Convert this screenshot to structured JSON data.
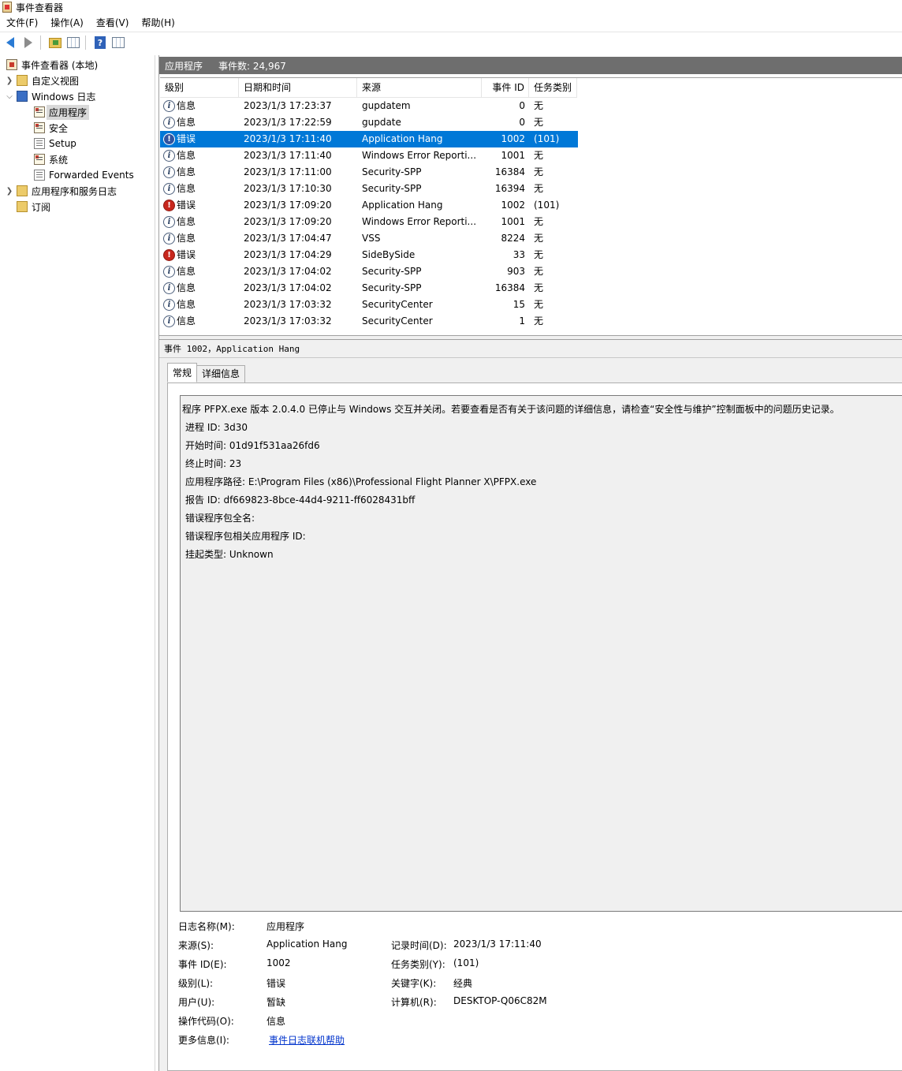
{
  "window": {
    "title": "事件查看器"
  },
  "menu": [
    "文件(F)",
    "操作(A)",
    "查看(V)",
    "帮助(H)"
  ],
  "nav": {
    "items": [
      {
        "label": "事件查看器 (本地)",
        "icon": "event-viewer-icon"
      },
      {
        "label": "自定义视图",
        "icon": "folder-icon"
      },
      {
        "label": "Windows 日志",
        "icon": "windows-log-icon"
      },
      {
        "label": "应用程序",
        "icon": "log-icon"
      },
      {
        "label": "安全",
        "icon": "log-icon"
      },
      {
        "label": "Setup",
        "icon": "doc-icon"
      },
      {
        "label": "系统",
        "icon": "log-icon"
      },
      {
        "label": "Forwarded Events",
        "icon": "doc-icon"
      },
      {
        "label": "应用程序和服务日志",
        "icon": "folder-icon"
      },
      {
        "label": "订阅",
        "icon": "subscription-icon"
      }
    ]
  },
  "list": {
    "name": "应用程序",
    "count": "事件数: 24,967",
    "columns": [
      "级别",
      "日期和时间",
      "来源",
      "事件 ID",
      "任务类别"
    ],
    "rows": [
      {
        "level": "信息",
        "type": "info",
        "date": "2023/1/3 17:23:37",
        "source": "gupdatem",
        "id": "0",
        "task": "无"
      },
      {
        "level": "信息",
        "type": "info",
        "date": "2023/1/3 17:22:59",
        "source": "gupdate",
        "id": "0",
        "task": "无"
      },
      {
        "level": "错误",
        "type": "error",
        "date": "2023/1/3 17:11:40",
        "source": "Application Hang",
        "id": "1002",
        "task": "(101)",
        "selected": true
      },
      {
        "level": "信息",
        "type": "info",
        "date": "2023/1/3 17:11:40",
        "source": "Windows Error Reporti...",
        "id": "1001",
        "task": "无"
      },
      {
        "level": "信息",
        "type": "info",
        "date": "2023/1/3 17:11:00",
        "source": "Security-SPP",
        "id": "16384",
        "task": "无"
      },
      {
        "level": "信息",
        "type": "info",
        "date": "2023/1/3 17:10:30",
        "source": "Security-SPP",
        "id": "16394",
        "task": "无"
      },
      {
        "level": "错误",
        "type": "error",
        "date": "2023/1/3 17:09:20",
        "source": "Application Hang",
        "id": "1002",
        "task": "(101)"
      },
      {
        "level": "信息",
        "type": "info",
        "date": "2023/1/3 17:09:20",
        "source": "Windows Error Reporti...",
        "id": "1001",
        "task": "无"
      },
      {
        "level": "信息",
        "type": "info",
        "date": "2023/1/3 17:04:47",
        "source": "VSS",
        "id": "8224",
        "task": "无"
      },
      {
        "level": "错误",
        "type": "error",
        "date": "2023/1/3 17:04:29",
        "source": "SideBySide",
        "id": "33",
        "task": "无"
      },
      {
        "level": "信息",
        "type": "info",
        "date": "2023/1/3 17:04:02",
        "source": "Security-SPP",
        "id": "903",
        "task": "无"
      },
      {
        "level": "信息",
        "type": "info",
        "date": "2023/1/3 17:04:02",
        "source": "Security-SPP",
        "id": "16384",
        "task": "无"
      },
      {
        "level": "信息",
        "type": "info",
        "date": "2023/1/3 17:03:32",
        "source": "SecurityCenter",
        "id": "15",
        "task": "无"
      },
      {
        "level": "信息",
        "type": "info",
        "date": "2023/1/3 17:03:32",
        "source": "SecurityCenter",
        "id": "1",
        "task": "无"
      }
    ]
  },
  "detail": {
    "title": "事件 1002，Application Hang",
    "tabs": [
      "常规",
      "详细信息"
    ],
    "description": [
      "程序 PFPX.exe 版本 2.0.4.0 已停止与 Windows 交互并关闭。若要查看是否有关于该问题的详细信息，请检查“安全性与维护”控制面板中的问题历史记录。",
      "进程 ID: 3d30",
      "开始时间: 01d91f531aa26fd6",
      "终止时间: 23",
      "应用程序路径: E:\\Program Files (x86)\\Professional Flight Planner X\\PFPX.exe",
      "报告 ID: df669823-8bce-44d4-9211-ff6028431bff",
      "错误程序包全名:",
      "错误程序包相关应用程序 ID:",
      "挂起类型: Unknown"
    ],
    "fields": {
      "log_name": {
        "label": "日志名称(M):",
        "value": "应用程序"
      },
      "source": {
        "label": "来源(S):",
        "value": "Application Hang"
      },
      "event_id": {
        "label": "事件 ID(E):",
        "value": "1002"
      },
      "level": {
        "label": "级别(L):",
        "value": "错误"
      },
      "user": {
        "label": "用户(U):",
        "value": "暂缺"
      },
      "opcode": {
        "label": "操作代码(O):",
        "value": "信息"
      },
      "more_info": {
        "label": "更多信息(I):",
        "value": "事件日志联机帮助"
      },
      "logged": {
        "label": "记录时间(D):",
        "value": "2023/1/3 17:11:40"
      },
      "task": {
        "label": "任务类别(Y):",
        "value": "(101)"
      },
      "keywords": {
        "label": "关键字(K):",
        "value": "经典"
      },
      "computer": {
        "label": "计算机(R):",
        "value": "DESKTOP-Q06C82M"
      }
    }
  }
}
